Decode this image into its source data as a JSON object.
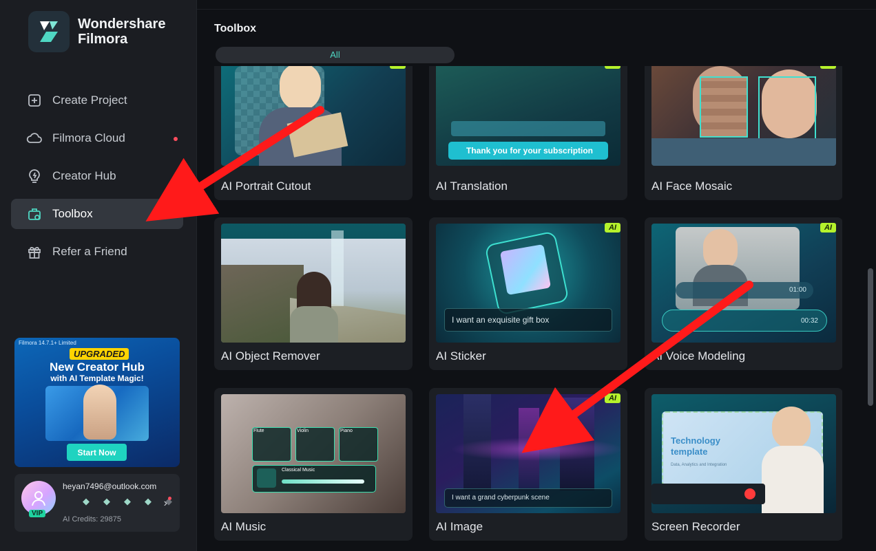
{
  "brand": {
    "line1": "Wondershare",
    "line2": "Filmora"
  },
  "nav": [
    {
      "label": "Create Project",
      "icon": "plus-square-icon",
      "dot": false,
      "active": false
    },
    {
      "label": "Filmora Cloud",
      "icon": "cloud-icon",
      "dot": true,
      "active": false
    },
    {
      "label": "Creator Hub",
      "icon": "bulb-icon",
      "dot": true,
      "active": false
    },
    {
      "label": "Toolbox",
      "icon": "toolbox-icon",
      "dot": false,
      "active": true
    },
    {
      "label": "Refer a Friend",
      "icon": "gift-icon",
      "dot": false,
      "active": false
    }
  ],
  "promo": {
    "small": "Filmora 14.7.1+ Limited",
    "tag": "UPGRADED",
    "title": "New Creator Hub",
    "subtitle": "with AI Template Magic!",
    "button": "Start Now"
  },
  "account": {
    "email": "heyan7496@outlook.com",
    "vip": "VIP",
    "credits": "AI Credits: 29875"
  },
  "main": {
    "title": "Toolbox",
    "tab": "All"
  },
  "cards": [
    {
      "label": "AI Portrait Cutout",
      "ai": "AI"
    },
    {
      "label": "AI Translation",
      "ai": "AI",
      "thumb_text_1": "Thank you for your subscription"
    },
    {
      "label": "AI Face Mosaic",
      "ai": "AI"
    },
    {
      "label": "AI Object Remover",
      "ai": ""
    },
    {
      "label": "AI Sticker",
      "ai": "AI",
      "prompt": "I want an exquisite gift box"
    },
    {
      "label": "AI Voice Modeling",
      "ai": "AI",
      "time1": "01:00",
      "time2": "00:32"
    },
    {
      "label": "AI Music",
      "ai": "",
      "instruments": [
        "Flute",
        "Violin",
        "Piano"
      ],
      "track": "Classical Music"
    },
    {
      "label": "AI Image",
      "ai": "AI",
      "prompt": "I want a grand cyberpunk scene"
    },
    {
      "label": "Screen Recorder",
      "ai": "",
      "slide_title": "Technology template",
      "slide_sub": "Data, Analytics and Integration"
    }
  ],
  "colors": {
    "accent": "#4fd7c3",
    "ai_badge": "#b6f22c",
    "dot": "#ff4d5e",
    "arrow": "#ff1a1a"
  }
}
